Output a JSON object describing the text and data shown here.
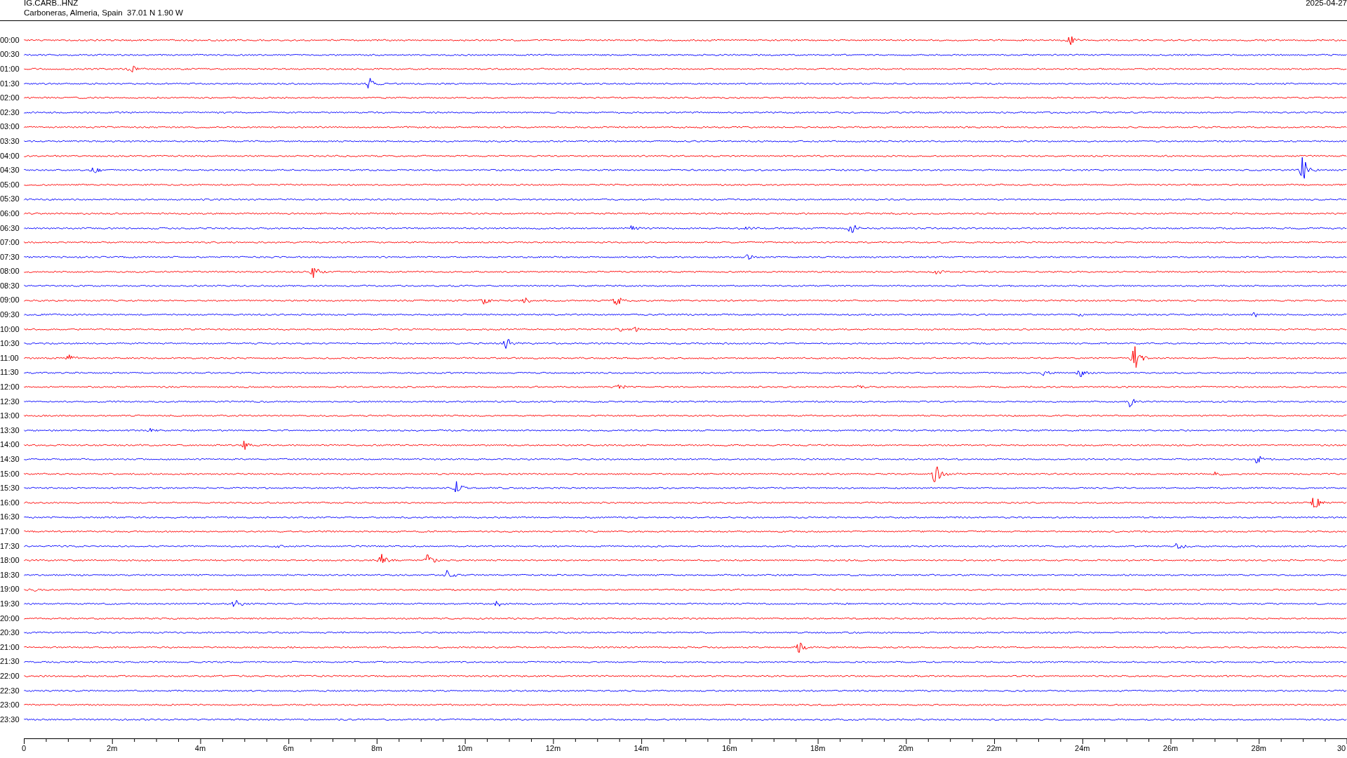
{
  "header": {
    "station": "IG.CARB..HNZ",
    "location": "Carboneras, Almeria, Spain  37.01 N 1.90 W",
    "date": "2025-04-27"
  },
  "traces": [
    {
      "time": "00:00",
      "color": "#ff0000"
    },
    {
      "time": "00:30",
      "color": "#0000ff"
    },
    {
      "time": "01:00",
      "color": "#ff0000"
    },
    {
      "time": "01:30",
      "color": "#0000ff"
    },
    {
      "time": "02:00",
      "color": "#ff0000"
    },
    {
      "time": "02:30",
      "color": "#0000ff"
    },
    {
      "time": "03:00",
      "color": "#ff0000"
    },
    {
      "time": "03:30",
      "color": "#0000ff"
    },
    {
      "time": "04:00",
      "color": "#ff0000"
    },
    {
      "time": "04:30",
      "color": "#0000ff"
    },
    {
      "time": "05:00",
      "color": "#ff0000"
    },
    {
      "time": "05:30",
      "color": "#0000ff"
    },
    {
      "time": "06:00",
      "color": "#ff0000"
    },
    {
      "time": "06:30",
      "color": "#0000ff"
    },
    {
      "time": "07:00",
      "color": "#ff0000"
    },
    {
      "time": "07:30",
      "color": "#0000ff"
    },
    {
      "time": "08:00",
      "color": "#ff0000"
    },
    {
      "time": "08:30",
      "color": "#0000ff"
    },
    {
      "time": "09:00",
      "color": "#ff0000"
    },
    {
      "time": "09:30",
      "color": "#0000ff"
    },
    {
      "time": "10:00",
      "color": "#ff0000"
    },
    {
      "time": "10:30",
      "color": "#0000ff"
    },
    {
      "time": "11:00",
      "color": "#ff0000"
    },
    {
      "time": "11:30",
      "color": "#0000ff"
    },
    {
      "time": "12:00",
      "color": "#ff0000"
    },
    {
      "time": "12:30",
      "color": "#0000ff"
    },
    {
      "time": "13:00",
      "color": "#ff0000"
    },
    {
      "time": "13:30",
      "color": "#0000ff"
    },
    {
      "time": "14:00",
      "color": "#ff0000"
    },
    {
      "time": "14:30",
      "color": "#0000ff"
    },
    {
      "time": "15:00",
      "color": "#ff0000"
    },
    {
      "time": "15:30",
      "color": "#0000ff"
    },
    {
      "time": "16:00",
      "color": "#ff0000"
    },
    {
      "time": "16:30",
      "color": "#0000ff"
    },
    {
      "time": "17:00",
      "color": "#ff0000"
    },
    {
      "time": "17:30",
      "color": "#0000ff"
    },
    {
      "time": "18:00",
      "color": "#ff0000"
    },
    {
      "time": "18:30",
      "color": "#0000ff"
    },
    {
      "time": "19:00",
      "color": "#ff0000"
    },
    {
      "time": "19:30",
      "color": "#0000ff"
    },
    {
      "time": "20:00",
      "color": "#ff0000"
    },
    {
      "time": "20:30",
      "color": "#0000ff"
    },
    {
      "time": "21:00",
      "color": "#ff0000"
    },
    {
      "time": "21:30",
      "color": "#0000ff"
    },
    {
      "time": "22:00",
      "color": "#ff0000"
    },
    {
      "time": "22:30",
      "color": "#0000ff"
    },
    {
      "time": "23:00",
      "color": "#ff0000"
    },
    {
      "time": "23:30",
      "color": "#0000ff"
    }
  ],
  "x_axis": {
    "labels": [
      "0",
      "2m",
      "4m",
      "6m",
      "8m",
      "10m",
      "12m",
      "14m",
      "16m",
      "18m",
      "20m",
      "22m",
      "24m",
      "26m",
      "28m",
      "30"
    ]
  }
}
